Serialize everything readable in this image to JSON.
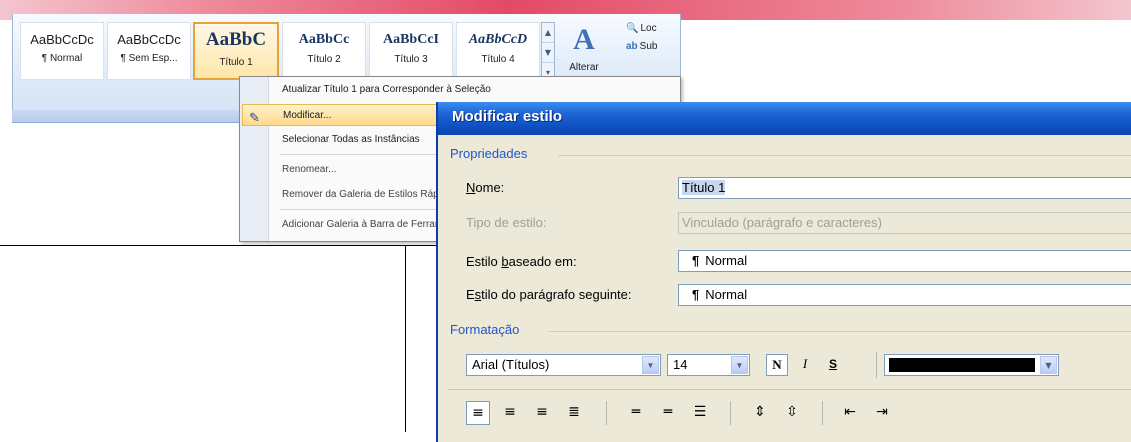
{
  "ribbon": {
    "styles": [
      {
        "sample": "AaBbCcDc",
        "name": "¶ Normal"
      },
      {
        "sample": "AaBbCcDc",
        "name": "¶ Sem Esp..."
      },
      {
        "sample": "AaBbC",
        "name": "Título 1"
      },
      {
        "sample": "AaBbCc",
        "name": "Título 2"
      },
      {
        "sample": "AaBbCcI",
        "name": "Título 3"
      },
      {
        "sample": "AaBbCcD",
        "name": "Título 4"
      }
    ],
    "alter_label": "Alterar",
    "find": [
      {
        "icon": "binoculars-icon",
        "glyph": "🔍",
        "label": "Loc"
      },
      {
        "icon": "replace-icon",
        "glyph": "ab",
        "label": "Sub"
      }
    ]
  },
  "context_menu": {
    "items": [
      {
        "label": "Atualizar Título 1 para Corresponder à Seleção"
      },
      {
        "label": "Modificar...",
        "highlighted": true
      },
      {
        "label": "Selecionar Todas as Instâncias"
      },
      {
        "label": "Renomear..."
      },
      {
        "label": "Remover da Galeria de Estilos Rápidos"
      },
      {
        "label": "Adicionar Galeria à Barra de Ferramentas"
      }
    ]
  },
  "dialog": {
    "title": "Modificar estilo",
    "properties_label": "Propriedades",
    "name_label": "Nome:",
    "name_value": "Título 1",
    "type_label": "Tipo de estilo:",
    "type_value": "Vinculado (parágrafo e caracteres)",
    "based_on_label": "Estilo baseado em:",
    "based_on_value": "Normal",
    "next_label": "Estilo do parágrafo seguinte:",
    "next_value": "Normal",
    "pilcrow": "¶",
    "formatting_label": "Formatação",
    "font_value": "Arial (Títulos)",
    "size_value": "14",
    "bold_label": "N",
    "italic_label": "I",
    "shadow_label": "S",
    "font_color": "#000000"
  }
}
